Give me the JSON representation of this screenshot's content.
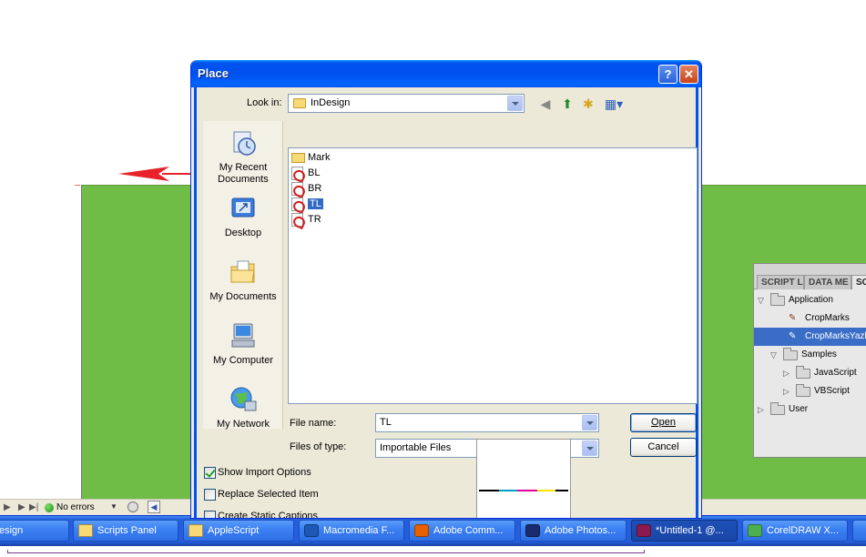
{
  "dialog": {
    "title": "Place",
    "help_label": "?",
    "close_label": "✕",
    "look_in_label": "Look in:",
    "look_in_value": "InDesign",
    "file_name_label": "File name:",
    "file_name_value": "TL",
    "files_of_type_label": "Files of type:",
    "files_of_type_value": "Importable Files",
    "open_button": "Open",
    "cancel_button": "Cancel",
    "places": [
      {
        "label1": "My Recent",
        "label2": "Documents",
        "icon": "recent-documents-icon"
      },
      {
        "label1": "Desktop",
        "label2": "",
        "icon": "desktop-icon"
      },
      {
        "label1": "My Documents",
        "label2": "",
        "icon": "my-documents-icon"
      },
      {
        "label1": "My Computer",
        "label2": "",
        "icon": "my-computer-icon"
      },
      {
        "label1": "My Network",
        "label2": "",
        "icon": "my-network-icon"
      }
    ],
    "files": [
      {
        "name": "Mark",
        "kind": "folder"
      },
      {
        "name": "BL",
        "kind": "pdf"
      },
      {
        "name": "BR",
        "kind": "pdf"
      },
      {
        "name": "TL",
        "kind": "pdf",
        "selected": true
      },
      {
        "name": "TR",
        "kind": "pdf"
      }
    ],
    "checkboxes": [
      {
        "label": "Show Import Options",
        "checked": true
      },
      {
        "label": "Replace Selected Item",
        "checked": false
      },
      {
        "label": "Create Static Captions",
        "checked": false
      }
    ],
    "preview_colors": [
      "#000000",
      "#00a0c6",
      "#e0009a",
      "#ffe500",
      "#000000"
    ]
  },
  "status_bar": {
    "errors_label": "No errors"
  },
  "scripts_panel": {
    "tabs": [
      "SCRIPT L",
      "DATA ME",
      "SC"
    ],
    "rows": [
      {
        "label": "Application",
        "level": 0,
        "type": "folder",
        "expanded": true
      },
      {
        "label": "CropMarks",
        "level": 2,
        "type": "script"
      },
      {
        "label": "CropMarksYazh",
        "level": 2,
        "type": "script",
        "selected": true
      },
      {
        "label": "Samples",
        "level": 1,
        "type": "folder",
        "expanded": true
      },
      {
        "label": "JavaScript",
        "level": 2,
        "type": "folder",
        "expanded": false
      },
      {
        "label": "VBScript",
        "level": 2,
        "type": "folder",
        "expanded": false
      },
      {
        "label": "User",
        "level": 0,
        "type": "folder",
        "expanded": false
      }
    ]
  },
  "taskbar": {
    "items": [
      {
        "label": "esign",
        "icon": "",
        "active": false
      },
      {
        "label": "Scripts Panel",
        "icon": "folder-icon",
        "active": false
      },
      {
        "label": "AppleScript",
        "icon": "folder-icon",
        "active": false
      },
      {
        "label": "Macromedia F...",
        "icon": "macromedia-icon",
        "active": false
      },
      {
        "label": "Adobe Comm...",
        "icon": "firefox-icon",
        "active": false
      },
      {
        "label": "Adobe Photos...",
        "icon": "photoshop-icon",
        "active": false
      },
      {
        "label": "*Untitled-1 @...",
        "icon": "indesign-icon",
        "active": true
      },
      {
        "label": "CorelDRAW X...",
        "icon": "coreldraw-icon",
        "active": false
      },
      {
        "label": "",
        "icon": "",
        "active": false
      }
    ]
  },
  "colors": {
    "page_green": "#6fbc46",
    "arrow_red": "#e8212a",
    "xp_blue": "#0053ee",
    "selection": "#316ac5"
  }
}
